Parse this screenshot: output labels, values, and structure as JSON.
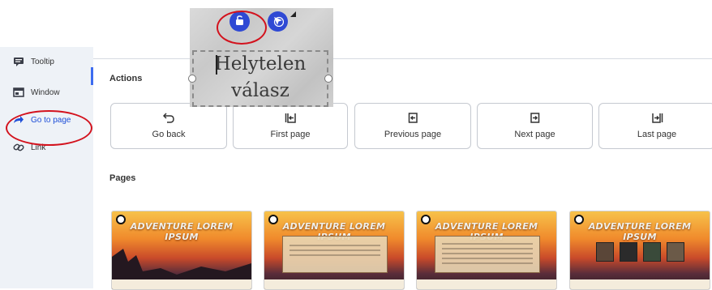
{
  "sidebar": {
    "items": [
      {
        "label": "Tooltip",
        "icon": "tooltip-icon"
      },
      {
        "label": "Window",
        "icon": "window-icon"
      },
      {
        "label": "Go to page",
        "icon": "go-to-page-arrow-icon"
      },
      {
        "label": "Link",
        "icon": "link-icon"
      }
    ],
    "active_index": 2
  },
  "actions": {
    "heading": "Actions",
    "buttons": [
      {
        "label": "Go back",
        "icon": "undo-arrow-icon"
      },
      {
        "label": "First page",
        "icon": "first-page-icon"
      },
      {
        "label": "Previous page",
        "icon": "previous-page-icon"
      },
      {
        "label": "Next page",
        "icon": "next-page-icon"
      },
      {
        "label": "Last page",
        "icon": "last-page-icon"
      }
    ]
  },
  "pages": {
    "heading": "Pages",
    "thumbnails": [
      {
        "title": "ADVENTURE LOREM IPSUM"
      },
      {
        "title": "ADVENTURE LOREM IPSUM"
      },
      {
        "title": "ADVENTURE LOREM IPSUM"
      },
      {
        "title": "ADVENTURE LOREM IPSUM"
      }
    ]
  },
  "floating_text": {
    "line1": "Helytelen",
    "line2": "válasz"
  },
  "colors": {
    "accent": "#2f49d4",
    "annotation_red": "#d3121d",
    "sidebar_bg": "#eef2f7",
    "active_link": "#1f4fd8"
  }
}
